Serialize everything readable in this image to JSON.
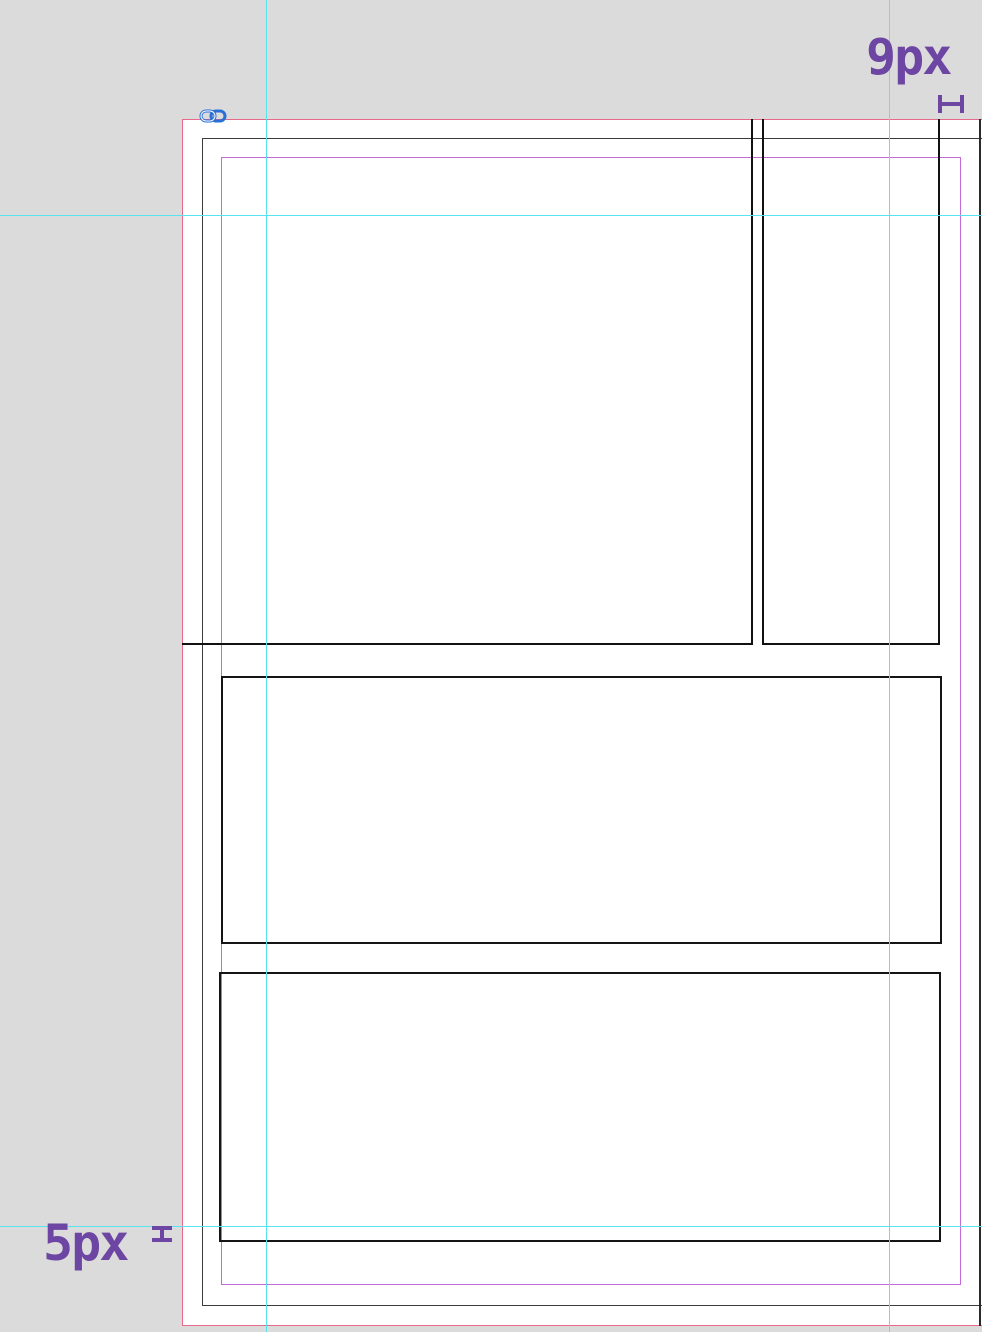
{
  "canvas": {
    "background_color": "#dcdbdc",
    "page_color": "#ffffff",
    "bleed_color": "#e86a8a",
    "trim_color": "#3b3b3b",
    "safe_area_color": "#c36ad8",
    "guide_color": "#59e3f0",
    "panel_border_color": "#151515"
  },
  "annotations": {
    "top_right_gap": "9px",
    "bottom_left_gap": "5px",
    "color": "#6d45a2"
  },
  "icons": {
    "link": "link-icon"
  },
  "panels": [
    {
      "name": "panel-top-left"
    },
    {
      "name": "panel-top-right"
    },
    {
      "name": "panel-middle"
    },
    {
      "name": "panel-bottom"
    }
  ]
}
